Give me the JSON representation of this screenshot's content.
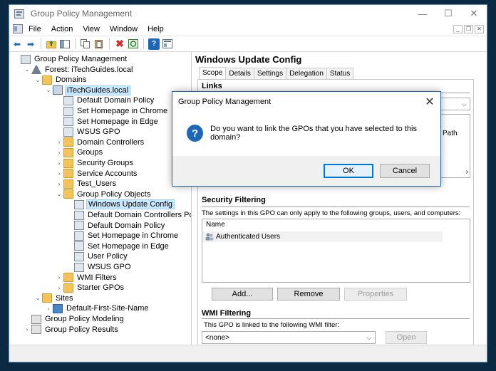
{
  "window": {
    "title": "Group Policy Management"
  },
  "menu": [
    "File",
    "Action",
    "View",
    "Window",
    "Help"
  ],
  "tree": [
    {
      "label": "Group Policy Management",
      "icon": "gpm-icon",
      "level": 0,
      "exp": ""
    },
    {
      "label": "Forest: iTechGuides.local",
      "icon": "forest-icon",
      "level": 1,
      "exp": "v"
    },
    {
      "label": "Domains",
      "icon": "folder-icon",
      "level": 2,
      "exp": "v"
    },
    {
      "label": "iTechGuides.local",
      "icon": "domain-icon",
      "level": 3,
      "exp": "v",
      "selected": true
    },
    {
      "label": "Default Domain Policy",
      "icon": "gpo-link-icon",
      "level": 4,
      "exp": ""
    },
    {
      "label": "Set Homepage in Chrome",
      "icon": "gpo-link-icon",
      "level": 4,
      "exp": ""
    },
    {
      "label": "Set Homepage in Edge",
      "icon": "gpo-link-icon",
      "level": 4,
      "exp": ""
    },
    {
      "label": "WSUS GPO",
      "icon": "gpo-link-icon",
      "level": 4,
      "exp": ""
    },
    {
      "label": "Domain Controllers",
      "icon": "ou-icon",
      "level": 4,
      "exp": ">"
    },
    {
      "label": "Groups",
      "icon": "ou-icon",
      "level": 4,
      "exp": ">"
    },
    {
      "label": "Security Groups",
      "icon": "ou-icon",
      "level": 4,
      "exp": ">"
    },
    {
      "label": "Service Accounts",
      "icon": "ou-icon",
      "level": 4,
      "exp": ">"
    },
    {
      "label": "Test_Users",
      "icon": "ou-icon",
      "level": 4,
      "exp": ">"
    },
    {
      "label": "Group Policy Objects",
      "icon": "folder-icon",
      "level": 4,
      "exp": "v"
    },
    {
      "label": "Windows Update Config",
      "icon": "gpo-icon",
      "level": 5,
      "exp": "",
      "selected": true
    },
    {
      "label": "Default Domain Controllers Policy",
      "icon": "gpo-icon",
      "level": 5,
      "exp": ""
    },
    {
      "label": "Default Domain Policy",
      "icon": "gpo-icon",
      "level": 5,
      "exp": ""
    },
    {
      "label": "Set Homepage in Chrome",
      "icon": "gpo-icon",
      "level": 5,
      "exp": ""
    },
    {
      "label": "Set Homepage in Edge",
      "icon": "gpo-icon",
      "level": 5,
      "exp": ""
    },
    {
      "label": "User Policy",
      "icon": "gpo-icon",
      "level": 5,
      "exp": ""
    },
    {
      "label": "WSUS GPO",
      "icon": "gpo-icon",
      "level": 5,
      "exp": ""
    },
    {
      "label": "WMI Filters",
      "icon": "folder-icon",
      "level": 4,
      "exp": ">"
    },
    {
      "label": "Starter GPOs",
      "icon": "folder-icon",
      "level": 4,
      "exp": ">"
    },
    {
      "label": "Sites",
      "icon": "folder-icon",
      "level": 2,
      "exp": "v"
    },
    {
      "label": "Default-First-Site-Name",
      "icon": "site-icon",
      "level": 3,
      "exp": ">"
    },
    {
      "label": "Group Policy Modeling",
      "icon": "modeling-icon",
      "level": 1,
      "exp": ""
    },
    {
      "label": "Group Policy Results",
      "icon": "results-icon",
      "level": 1,
      "exp": ">"
    }
  ],
  "details": {
    "title": "Windows Update Config",
    "tabs": [
      "Scope",
      "Details",
      "Settings",
      "Delegation",
      "Status"
    ],
    "links_heading": "Links",
    "path_header": "Path",
    "security": {
      "heading": "Security Filtering",
      "description": "The settings in this GPO can only apply to the following groups, users, and computers:",
      "column_name": "Name",
      "entries": [
        "Authenticated Users"
      ],
      "add_label": "Add...",
      "remove_label": "Remove",
      "properties_label": "Properties"
    },
    "wmi": {
      "heading": "WMI Filtering",
      "description": "This GPO is linked to the following WMI filter:",
      "selected": "<none>",
      "open_label": "Open"
    }
  },
  "dialog": {
    "title": "Group Policy Management",
    "message": "Do you want to link the GPOs that you have selected to this domain?",
    "ok_label": "OK",
    "cancel_label": "Cancel"
  },
  "colors": {
    "accent": "#0078d7",
    "desktop": "#0b2942",
    "selection": "#cce8ff"
  }
}
